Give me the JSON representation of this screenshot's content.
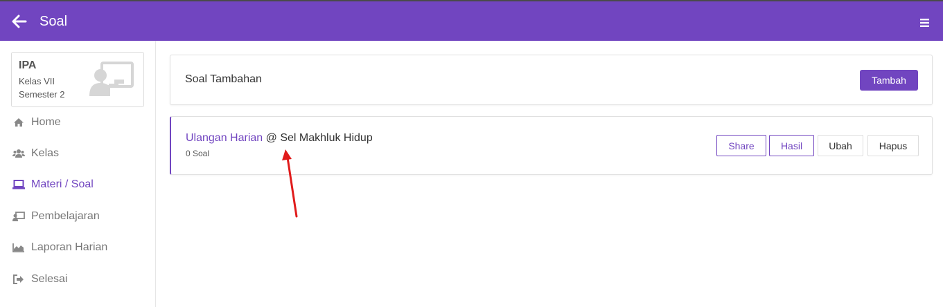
{
  "header": {
    "title": "Soal",
    "back_icon": "arrow-left-icon",
    "menu_icon": "hamburger-icon",
    "color": "#7145c0"
  },
  "course": {
    "name": "IPA",
    "class": "Kelas VII",
    "semester": "Semester 2",
    "icon": "teacher-board-icon"
  },
  "sidebar": {
    "items": [
      {
        "label": "Home",
        "icon": "home-icon",
        "active": false
      },
      {
        "label": "Kelas",
        "icon": "users-icon",
        "active": false
      },
      {
        "label": "Materi / Soal",
        "icon": "laptop-icon",
        "active": true
      },
      {
        "label": "Pembelajaran",
        "icon": "teacher-board-icon",
        "active": false
      },
      {
        "label": "Laporan Harian",
        "icon": "area-chart-icon",
        "active": false
      },
      {
        "label": "Selesai",
        "icon": "sign-out-icon",
        "active": false
      }
    ]
  },
  "main": {
    "header_panel": {
      "title": "Soal Tambahan",
      "add_label": "Tambah"
    },
    "quiz": {
      "category": "Ulangan Harian",
      "separator": " @ ",
      "subject": "Sel Makhluk Hidup",
      "count": "0 Soal",
      "actions": {
        "share": "Share",
        "result": "Hasil",
        "edit": "Ubah",
        "delete": "Hapus"
      }
    }
  },
  "colors": {
    "accent": "#7145c0",
    "annotation": "#e01b1b"
  }
}
